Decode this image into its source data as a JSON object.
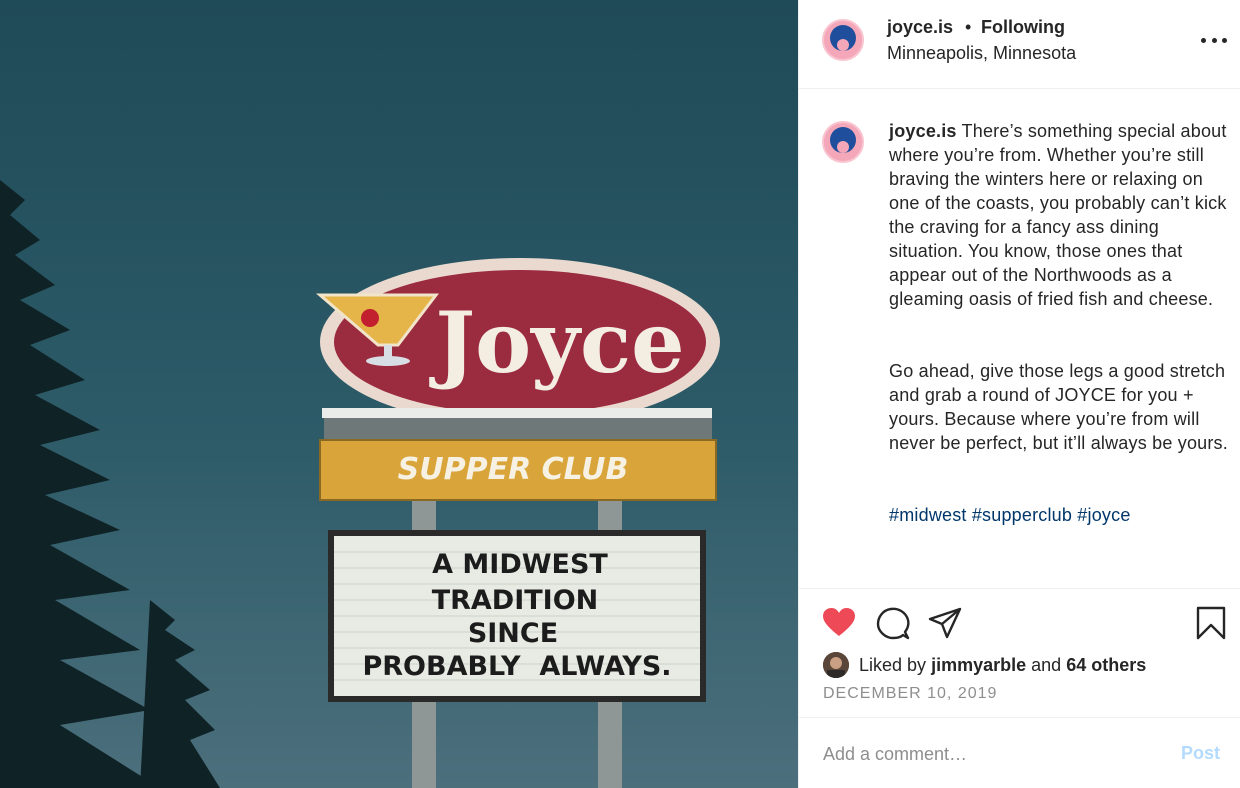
{
  "photo": {
    "sign_name": "Joyce",
    "sign_sub": "SUPPER CLUB",
    "marquee_lines": [
      "A MIDWEST",
      "TRADITION",
      "SINCE",
      "PROBABLY  ALWAYS."
    ]
  },
  "header": {
    "username": "joyce.is",
    "separator": "•",
    "follow_status": "Following",
    "location": "Minneapolis, Minnesota"
  },
  "caption": {
    "username": "joyce.is",
    "paragraph1": "There’s something special about where you’re from. Whether you’re still braving the winters here or relaxing on one of the coasts, you probably can’t kick the craving for a fancy ass dining situation. You know, those ones that appear out of the Northwoods as a gleaming oasis of fried fish and cheese.",
    "paragraph2": "Go ahead, give those legs a good stretch and grab a round of JOYCE for you + yours. Because where you’re from will never be perfect, but it’ll always be yours.",
    "hashtags": "#midwest #supperclub #joyce"
  },
  "actions": {
    "liked_prefix": "Liked by",
    "liked_user": "jimmyarble",
    "liked_and": "and",
    "liked_others": "64 others",
    "date": "DECEMBER 10, 2019",
    "like_color": "#ed4956"
  },
  "comment": {
    "placeholder": "Add a comment…",
    "post_label": "Post"
  }
}
